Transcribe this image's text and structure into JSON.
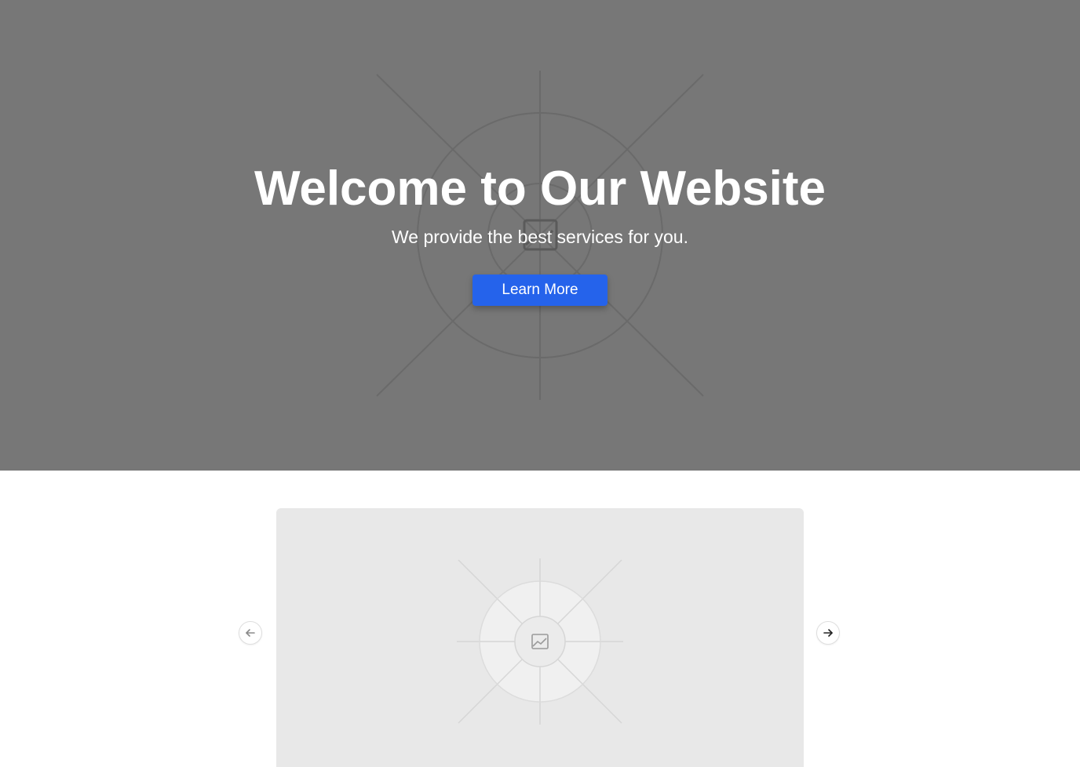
{
  "hero": {
    "title": "Welcome to Our Website",
    "subtitle": "We provide the best services for you.",
    "cta_label": "Learn More",
    "background_color": "#777777",
    "accent_color": "#2563eb"
  },
  "carousel": {
    "prev_icon": "arrow-left-icon",
    "next_icon": "arrow-right-icon",
    "slide_icon": "image-placeholder-icon",
    "slide_background": "#e8e8e8"
  }
}
